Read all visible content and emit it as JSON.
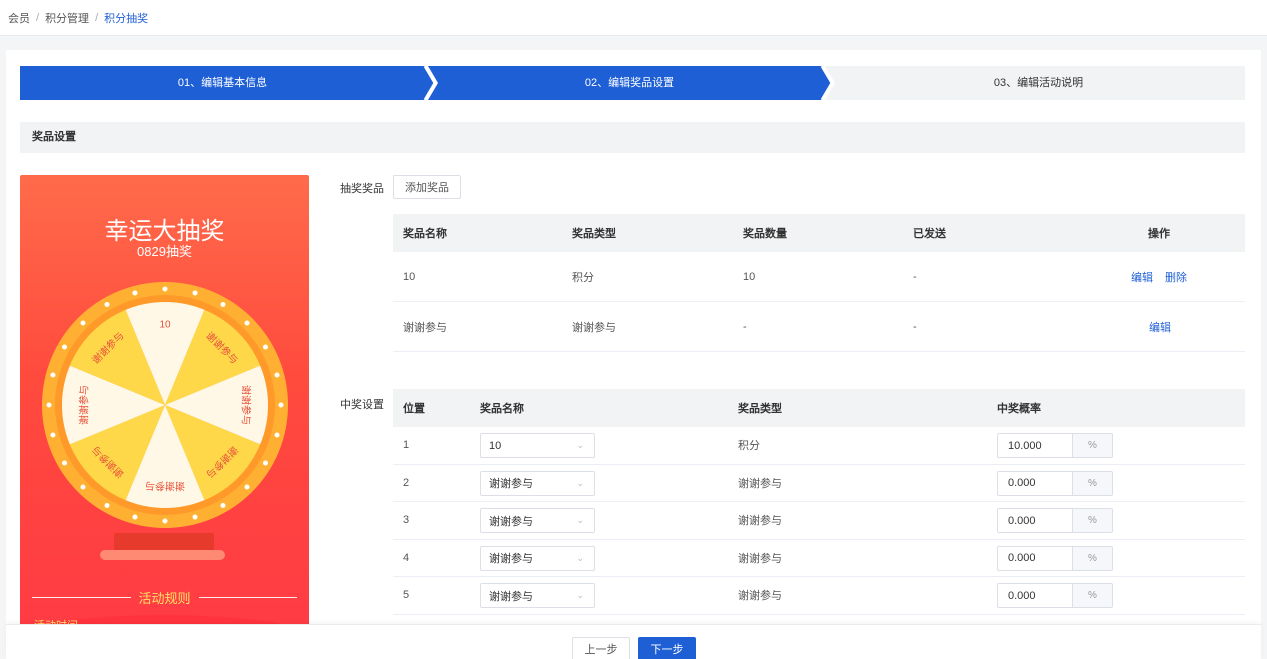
{
  "breadcrumb": [
    "会员",
    "积分管理",
    "积分抽奖"
  ],
  "steps": [
    {
      "label": "01、编辑基本信息",
      "state": "done"
    },
    {
      "label": "02、编辑奖品设置",
      "state": "active"
    },
    {
      "label": "03、编辑活动说明",
      "state": "todo"
    }
  ],
  "section_title": "奖品设置",
  "preview": {
    "title": "幸运大抽奖",
    "subtitle": "0829抽奖",
    "wheel_segments": [
      "10",
      "谢谢参与",
      "谢谢参与",
      "谢谢参与",
      "谢谢参与",
      "谢谢参与",
      "谢谢参与",
      "谢谢参与"
    ],
    "rules_title": "活动规则",
    "time_label": "活动时间"
  },
  "prizes": {
    "label": "抽奖奖品",
    "add_button": "添加奖品",
    "columns": [
      "奖品名称",
      "奖品类型",
      "奖品数量",
      "已发送",
      "操作"
    ],
    "rows": [
      {
        "name": "10",
        "type": "积分",
        "qty": "10",
        "sent": "-",
        "actions": [
          "编辑",
          "删除"
        ]
      },
      {
        "name": "谢谢参与",
        "type": "谢谢参与",
        "qty": "-",
        "sent": "-",
        "actions": [
          "编辑"
        ]
      }
    ]
  },
  "win_settings": {
    "label": "中奖设置",
    "columns": [
      "位置",
      "奖品名称",
      "奖品类型",
      "中奖概率"
    ],
    "unit": "%",
    "rows": [
      {
        "pos": "1",
        "prize": "10",
        "type": "积分",
        "prob": "10.000"
      },
      {
        "pos": "2",
        "prize": "谢谢参与",
        "type": "谢谢参与",
        "prob": "0.000"
      },
      {
        "pos": "3",
        "prize": "谢谢参与",
        "type": "谢谢参与",
        "prob": "0.000"
      },
      {
        "pos": "4",
        "prize": "谢谢参与",
        "type": "谢谢参与",
        "prob": "0.000"
      },
      {
        "pos": "5",
        "prize": "谢谢参与",
        "type": "谢谢参与",
        "prob": "0.000"
      }
    ]
  },
  "footer": {
    "prev": "上一步",
    "next": "下一步"
  },
  "colors": {
    "primary": "#1f5fd6",
    "preview_bg": "#ff4a3e",
    "wheel_yellow": "#ffd84a",
    "wheel_cream": "#fff8e6"
  }
}
